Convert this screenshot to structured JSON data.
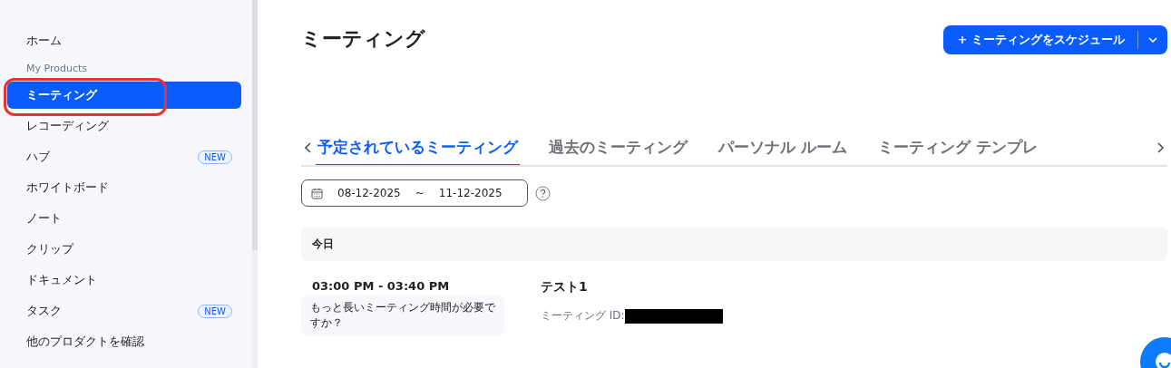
{
  "sidebar": {
    "items": [
      {
        "label": "ホーム",
        "kind": "item",
        "selected": false
      },
      {
        "label": "My Products",
        "kind": "heading"
      },
      {
        "label": "ミーティング",
        "kind": "item",
        "selected": true,
        "annotated": true
      },
      {
        "label": "レコーディング",
        "kind": "item",
        "selected": false
      },
      {
        "label": "ハブ",
        "kind": "item",
        "selected": false,
        "badge": "NEW"
      },
      {
        "label": "ホワイトボード",
        "kind": "item",
        "selected": false
      },
      {
        "label": "ノート",
        "kind": "item",
        "selected": false
      },
      {
        "label": "クリップ",
        "kind": "item",
        "selected": false
      },
      {
        "label": "ドキュメント",
        "kind": "item",
        "selected": false
      },
      {
        "label": "タスク",
        "kind": "item",
        "selected": false,
        "badge": "NEW"
      },
      {
        "label": "他のプロダクトを確認",
        "kind": "item",
        "selected": false
      }
    ]
  },
  "page_title": "ミーティング",
  "schedule_button": {
    "icon": "+",
    "label": "ミーティングをスケジュール"
  },
  "tabs": [
    {
      "label": "予定されているミーティング",
      "selected": true
    },
    {
      "label": "過去のミーティング",
      "selected": false
    },
    {
      "label": "パーソナル ルーム",
      "selected": false
    },
    {
      "label": "ミーティング テンプレ",
      "selected": false
    }
  ],
  "date_range": {
    "start": "08-12-2025",
    "separator": "~",
    "end": "11-12-2025"
  },
  "day_header": "今日",
  "meetings": [
    {
      "time": "03:00 PM - 03:40 PM",
      "prompt": "もっと長いミーティング時間が必要ですか？",
      "title": "テスト1",
      "id_label": "ミーティング ID:",
      "id_redacted": true
    }
  ]
}
